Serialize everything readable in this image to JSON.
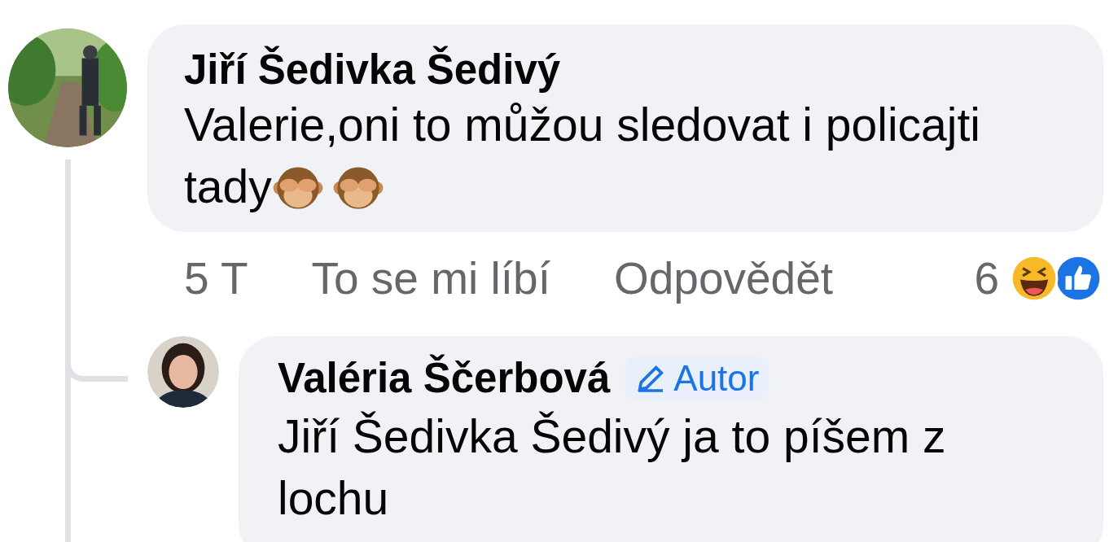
{
  "comment": {
    "author": "Jiří Šedivka Šedivý",
    "text": "Valerie,oni to můžou sledovat i policajti tady",
    "emojis": [
      {
        "kind": "monkey"
      },
      {
        "kind": "monkey"
      }
    ],
    "time": "5 T",
    "actions": [
      "To se mi líbí",
      "Odpovědět"
    ],
    "reaction_count": "6",
    "reactions": [
      {
        "kind": "haha"
      },
      {
        "kind": "like"
      }
    ],
    "replies": [
      {
        "author": "Valéria Ščerbová",
        "badge": "Autor",
        "text": "Jiří Šedivka Šedivý ja to píšem z lochu"
      }
    ]
  }
}
